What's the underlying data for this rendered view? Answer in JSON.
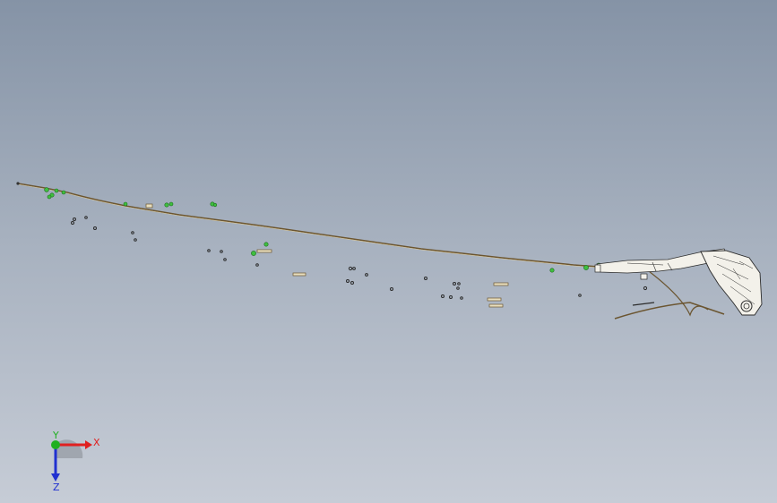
{
  "viewport": {
    "background_top": "#8593a6",
    "background_bottom": "#c6ccd6"
  },
  "model": {
    "cable_color": "#6b5530",
    "component_color": "#f3f1ea",
    "clip_color": "#3fbf3f",
    "fastener_color": "#2b2b2b",
    "tube_color": "#e8dfbf"
  },
  "triad": {
    "x_label": "X",
    "y_label": "Y",
    "z_label": "Z",
    "x_color": "#e02020",
    "y_color": "#20b020",
    "z_color": "#2030d0"
  }
}
